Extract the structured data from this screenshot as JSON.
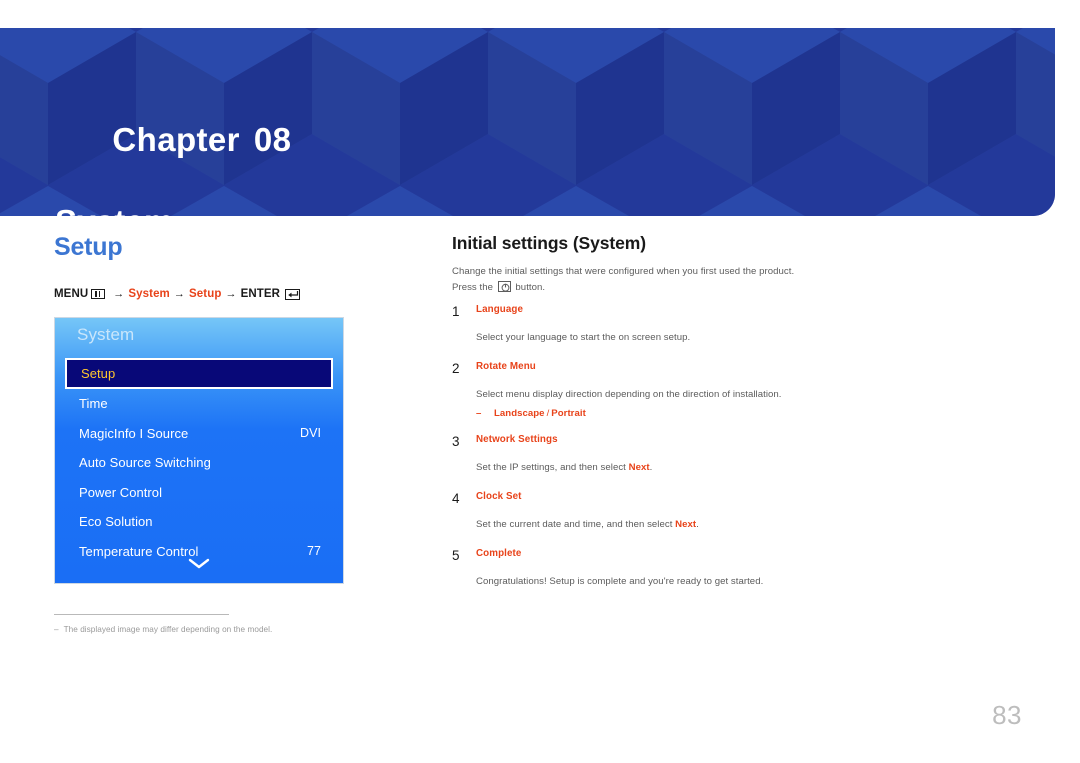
{
  "banner": {
    "chapter_label": "Chapter",
    "chapter_number": "08",
    "chapter_name": "System",
    "bg_color": "#23399a"
  },
  "left": {
    "section_title": "Setup",
    "menu_path": {
      "menu_label": "MENU",
      "menu_icon": "menu-grid-icon",
      "arrow": "→",
      "step1": "System",
      "step2": "Setup",
      "enter_label": "ENTER",
      "enter_icon": "enter-key-icon",
      "accent_color": "#e8431a"
    },
    "osd": {
      "title": "System",
      "selected_color": "#ffc62e",
      "items": [
        {
          "label": "Setup",
          "value": "",
          "selected": true
        },
        {
          "label": "Time",
          "value": "",
          "selected": false
        },
        {
          "label": "MagicInfo I Source",
          "value": "DVI",
          "selected": false
        },
        {
          "label": "Auto Source Switching",
          "value": "",
          "selected": false
        },
        {
          "label": "Power Control",
          "value": "",
          "selected": false
        },
        {
          "label": "Eco Solution",
          "value": "",
          "selected": false
        },
        {
          "label": "Temperature Control",
          "value": "77",
          "selected": false
        }
      ],
      "more_icon": "chevron-down-icon"
    },
    "footnote": {
      "dash": "–",
      "text": "The displayed image may differ depending on the model."
    }
  },
  "right": {
    "title": "Initial settings (System)",
    "intro_line1": "Change the initial settings that were configured when you first used the product.",
    "intro_before_icon": "Press the",
    "intro_icon": "power-button-icon",
    "intro_after_icon": "button.",
    "steps": [
      {
        "num": "1",
        "title": "Language",
        "desc_before": "Select your language to start the on screen setup.",
        "desc_bold": "",
        "desc_after": "",
        "sub": null
      },
      {
        "num": "2",
        "title": "Rotate Menu",
        "desc_before": "Select menu display direction depending on the direction of installation.",
        "desc_bold": "",
        "desc_after": "",
        "sub": {
          "dash": "–",
          "option1": "Landscape",
          "separator": "/",
          "option2": "Portrait"
        }
      },
      {
        "num": "3",
        "title": "Network Settings",
        "desc_before": "Set the IP settings, and then select ",
        "desc_bold": "Next",
        "desc_after": ".",
        "sub": null
      },
      {
        "num": "4",
        "title": "Clock Set",
        "desc_before": "Set the current date and time, and then select ",
        "desc_bold": "Next",
        "desc_after": ".",
        "sub": null
      },
      {
        "num": "5",
        "title": "Complete",
        "desc_before": "Congratulations! Setup is complete and you're ready to get started.",
        "desc_bold": "",
        "desc_after": "",
        "sub": null
      }
    ]
  },
  "page_number": "83"
}
